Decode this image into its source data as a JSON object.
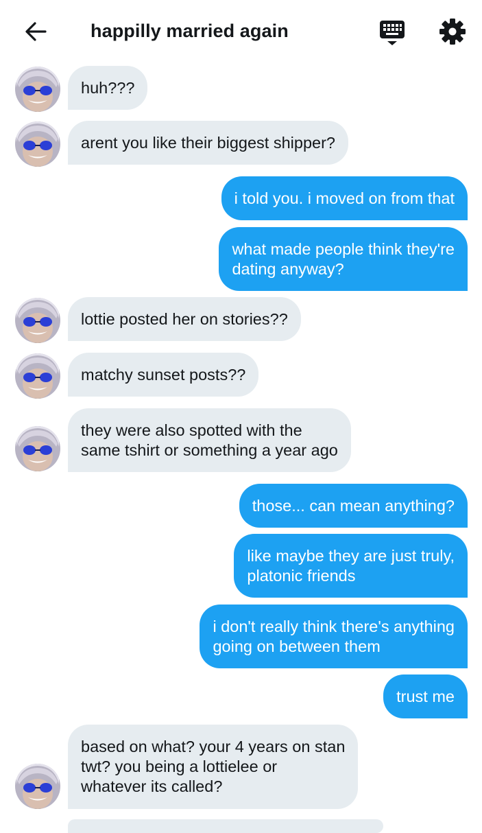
{
  "header": {
    "title": "happilly married again",
    "back_icon": "arrow-left-icon",
    "keyboard_icon": "keyboard-icon",
    "settings_icon": "gear-icon"
  },
  "colors": {
    "incoming_bubble": "#e6ecf0",
    "outgoing_bubble": "#1da1f2",
    "avatar_bg": "#b8b4c4"
  },
  "messages": [
    {
      "dir": "in",
      "lines": [
        "huh???"
      ]
    },
    {
      "dir": "in",
      "lines": [
        "arent you like their biggest shipper?"
      ]
    },
    {
      "dir": "out",
      "lines": [
        "i told you. i moved on from that"
      ]
    },
    {
      "dir": "out",
      "lines": [
        "what made people think they're",
        "dating anyway?"
      ]
    },
    {
      "dir": "in",
      "lines": [
        "lottie posted her on stories??"
      ]
    },
    {
      "dir": "in",
      "lines": [
        "matchy sunset posts??"
      ]
    },
    {
      "dir": "in",
      "lines": [
        "they were also spotted with the",
        "same tshirt or something a year ago"
      ]
    },
    {
      "dir": "out",
      "lines": [
        "those... can mean anything?"
      ]
    },
    {
      "dir": "out",
      "lines": [
        "like maybe they are just truly,",
        "platonic friends"
      ]
    },
    {
      "dir": "out",
      "lines": [
        "i don't really think there's anything",
        "going on between them"
      ]
    },
    {
      "dir": "out",
      "lines": [
        "trust me"
      ]
    },
    {
      "dir": "in",
      "lines": [
        "based on what? your 4 years on stan",
        "twt? you being a lottielee or",
        "whatever its called?"
      ]
    }
  ]
}
